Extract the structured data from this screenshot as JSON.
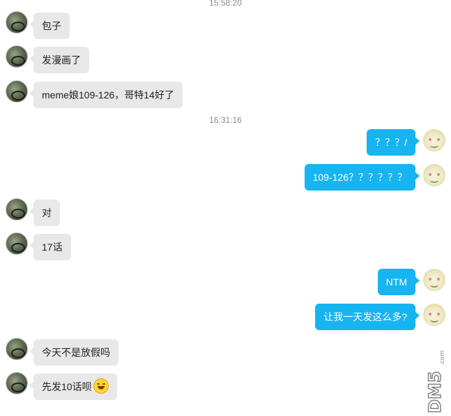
{
  "conversation": {
    "timestamps": [
      "15:58:20",
      "16:31:16"
    ],
    "messages": [
      {
        "side": "left",
        "text": "包子"
      },
      {
        "side": "left",
        "text": "发漫画了"
      },
      {
        "side": "left",
        "text": "meme娘109-126，哥特14好了"
      },
      {
        "side": "right",
        "text": "？？？/"
      },
      {
        "side": "right",
        "text": "109-126？？？？？？"
      },
      {
        "side": "left",
        "text": "对"
      },
      {
        "side": "left",
        "text": "17话"
      },
      {
        "side": "right",
        "text": "NTM"
      },
      {
        "side": "right",
        "text": "让我一天发这么多?"
      },
      {
        "side": "left",
        "text": "今天不是放假吗"
      },
      {
        "side": "left",
        "text": "先发10话呗",
        "emoji": "grinning-face"
      }
    ]
  },
  "watermark": {
    "text": "DM5",
    "domain": ".com"
  },
  "colors": {
    "outgoing_bubble": "#17b4f2",
    "incoming_bubble": "#e8e8e8",
    "timestamp_text": "#8c8c8c"
  }
}
